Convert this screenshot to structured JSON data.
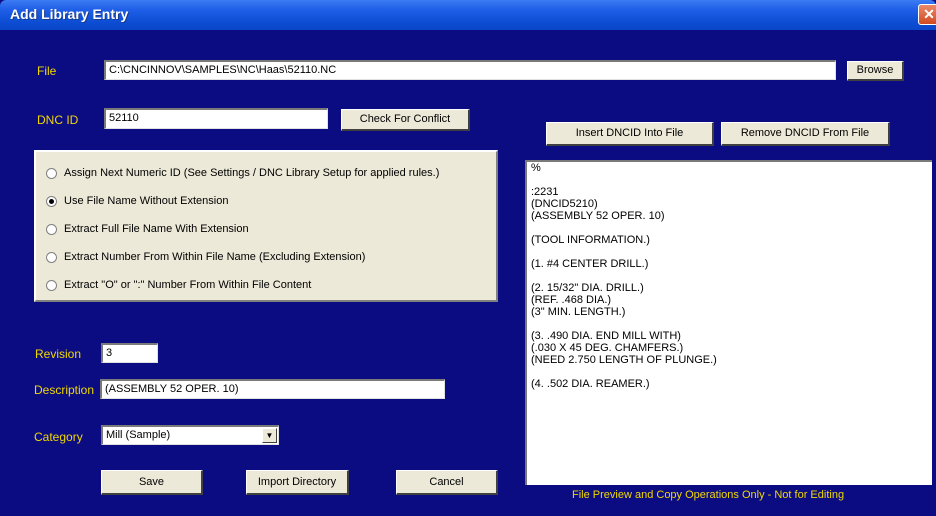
{
  "window": {
    "title": "Add Library Entry",
    "close_glyph": "✕"
  },
  "file": {
    "label": "File",
    "value": "C:\\CNCINNOV\\SAMPLES\\NC\\Haas\\52110.NC",
    "browse_label": "Browse"
  },
  "dnc": {
    "label": "DNC ID",
    "value": "52110",
    "check_label": "Check For Conflict"
  },
  "id_options": [
    {
      "label": "Assign Next Numeric ID (See Settings / DNC Library Setup for applied rules.)",
      "selected": false
    },
    {
      "label": "Use File Name Without Extension",
      "selected": true
    },
    {
      "label": "Extract Full File Name With Extension",
      "selected": false
    },
    {
      "label": "Extract Number From Within File Name (Excluding Extension)",
      "selected": false
    },
    {
      "label": "Extract \"O\" or \":\" Number  From Within File Content",
      "selected": false
    }
  ],
  "revision": {
    "label": "Revision",
    "value": "3"
  },
  "description": {
    "label": "Description",
    "value": "(ASSEMBLY 52 OPER. 10)"
  },
  "category": {
    "label": "Category",
    "value": "Mill (Sample)"
  },
  "buttons": {
    "save": "Save",
    "import": "Import Directory",
    "cancel": "Cancel",
    "insert": "Insert DNCID Into File",
    "remove": "Remove DNCID From File"
  },
  "preview": {
    "lines": [
      "%",
      "",
      ":2231",
      "(DNCID5210)",
      "(ASSEMBLY 52 OPER. 10)",
      "",
      "(TOOL INFORMATION.)",
      "",
      "(1. #4 CENTER DRILL.)",
      "",
      "(2. 15/32\" DIA. DRILL.)",
      "(REF. .468 DIA.)",
      "(3\" MIN. LENGTH.)",
      "",
      "(3. .490 DIA. END MILL WITH)",
      "(.030 X 45 DEG. CHAMFERS.)",
      "(NEED 2.750 LENGTH OF PLUNGE.)",
      "",
      "(4. .502 DIA. REAMER.)"
    ],
    "note": "File Preview and Copy Operations Only - Not for Editing"
  },
  "colors": {
    "background": "#0c0c82",
    "label": "#f0d800",
    "titlebar": "#0a46c8"
  }
}
